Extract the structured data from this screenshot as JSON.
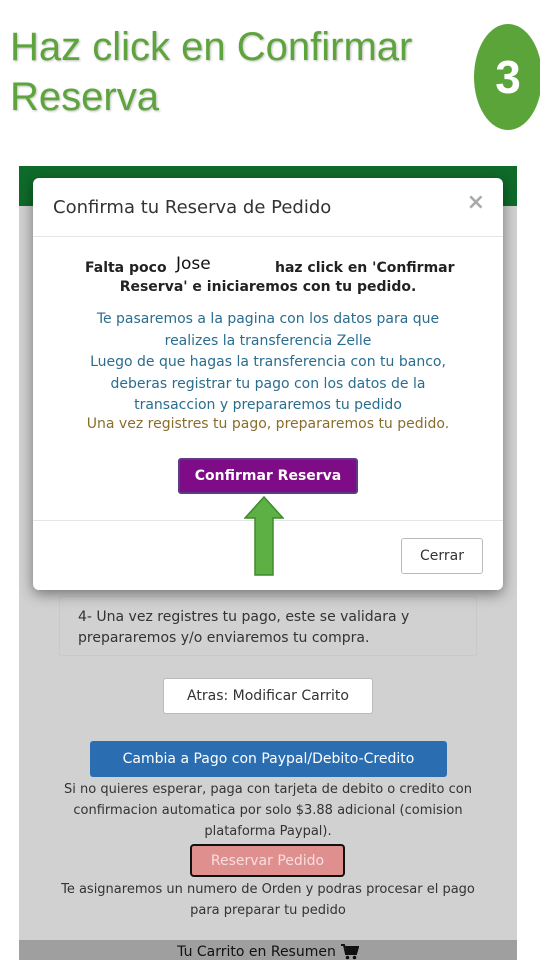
{
  "instruction": {
    "line1": "Haz click en Confirmar",
    "line2": "Reserva",
    "step_number": "3"
  },
  "colors": {
    "instruction_green": "#5ea43d",
    "header_green": "#0f6b2a",
    "confirm_purple": "#7e0c86",
    "paypal_blue": "#2a6db0",
    "reservar_red": "#e08f8f",
    "arrow_green": "#5cb044"
  },
  "modal": {
    "title": "Confirma tu Reserva de Pedido",
    "close_symbol": "×",
    "falta_part1": "Falta poco",
    "user_name": "Jose",
    "falta_part2": "haz click en 'Confirmar",
    "falta_line2": "Reserva' e iniciaremos con tu pedido.",
    "info_lines": [
      "Te pasaremos a la pagina con los datos para que",
      "realizes la transferencia Zelle",
      "Luego de que hagas la transferencia con tu banco,",
      "deberas registrar tu pago con los datos de la",
      "transaccion y prepararemos tu pedido"
    ],
    "payment_note": "Una vez registres tu pago, prepararemos tu pedido.",
    "confirm_label": "Confirmar Reserva",
    "close_label": "Cerrar"
  },
  "page": {
    "step4_line1": "4- Una vez registres tu pago, este se validara y",
    "step4_line2": "prepararemos y/o enviaremos tu compra.",
    "back_label": "Atras: Modificar Carrito",
    "paypal_label": "Cambia a Pago con Paypal/Debito-Credito",
    "paypal_note_lines": [
      "Si no quieres esperar, paga con tarjeta de debito o credito con",
      "confirmacion automatica por solo $3.88 adicional (comision",
      "plataforma Paypal)."
    ],
    "reservar_label": "Reservar Pedido",
    "orden_note_lines": [
      "Te asignaremos un numero de Orden y podras procesar el pago",
      "para preparar tu pedido"
    ],
    "cart_summary": "Tu Carrito en Resumen",
    "cart_icon": "shopping-cart-icon"
  }
}
